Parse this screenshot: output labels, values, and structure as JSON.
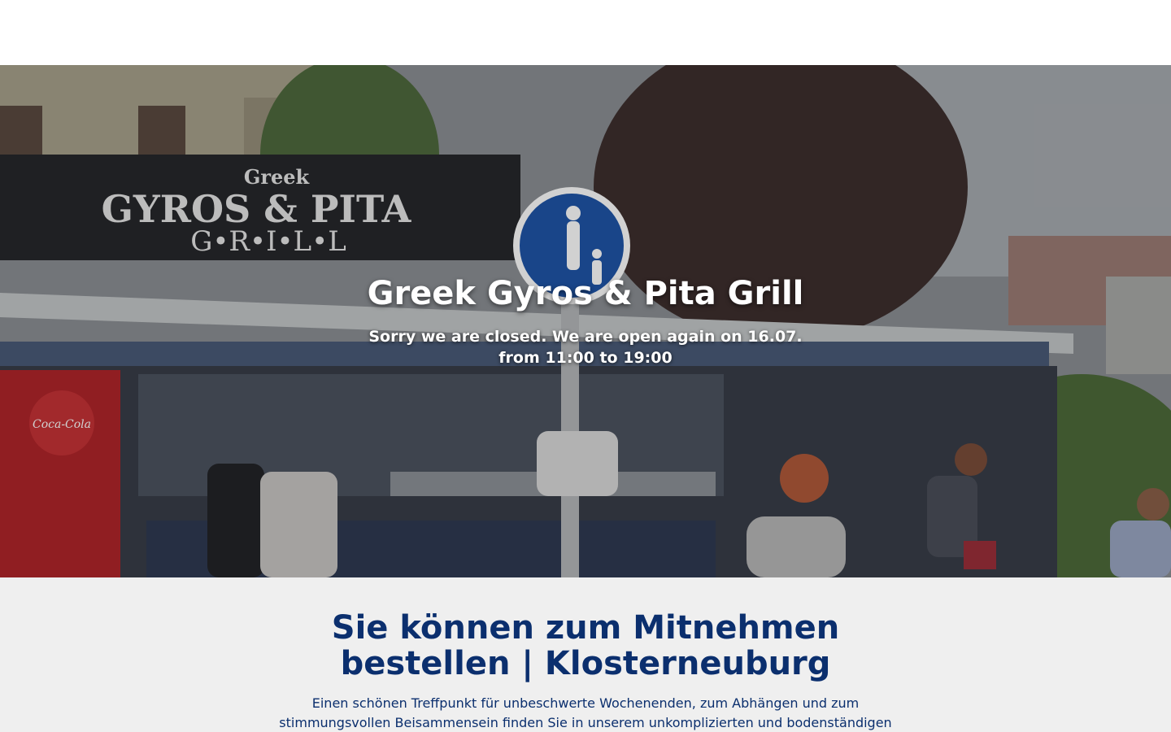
{
  "hero": {
    "sign_small": "Greek",
    "sign_main": "GYROS & PITA",
    "sign_sub": "G•R•I•L•L",
    "cola_sign": "Coca-Cola",
    "title": "Greek Gyros & Pita Grill",
    "closed_line1": "Sorry we are closed. We are open again on 16.07.",
    "closed_line2": "from 11:00 to 19:00"
  },
  "intro": {
    "heading_line1": "Sie können zum Mitnehmen",
    "heading_line2": "bestellen | Klosterneuburg",
    "text_line1": "Einen schönen Treffpunkt für unbeschwerte Wochenenden, zum Abhängen und zum",
    "text_line2": "stimmungsvollen Beisammensein finden Sie in unserem unkomplizierten und bodenständigen"
  },
  "colors": {
    "heading": "#0b2f6e",
    "content_bg": "#efefef",
    "header_bg": "#ffffff"
  }
}
